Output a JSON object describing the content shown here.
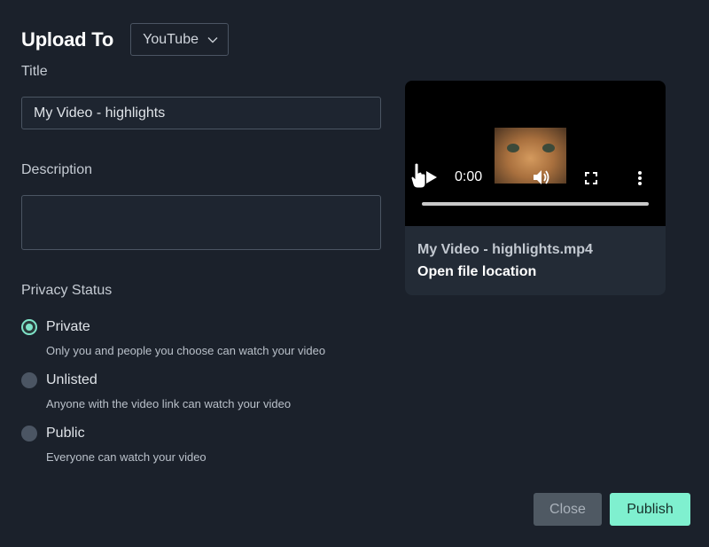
{
  "header": {
    "title": "Upload To",
    "platform": "YouTube"
  },
  "form": {
    "title_label": "Title",
    "title_value": "My Video - highlights",
    "description_label": "Description",
    "description_value": "",
    "privacy_label": "Privacy Status",
    "privacy_options": [
      {
        "label": "Private",
        "description": "Only you and people you choose can watch your video",
        "selected": true
      },
      {
        "label": "Unlisted",
        "description": "Anyone with the video link can watch your video",
        "selected": false
      },
      {
        "label": "Public",
        "description": "Everyone can watch your video",
        "selected": false
      }
    ]
  },
  "preview": {
    "time": "0:00",
    "progress": 0,
    "file_name": "My Video - highlights.mp4",
    "open_location": "Open file location"
  },
  "buttons": {
    "close": "Close",
    "publish": "Publish"
  },
  "colors": {
    "background": "#1b212b",
    "accent": "#7ff0cf",
    "close_button": "#4f5963"
  }
}
